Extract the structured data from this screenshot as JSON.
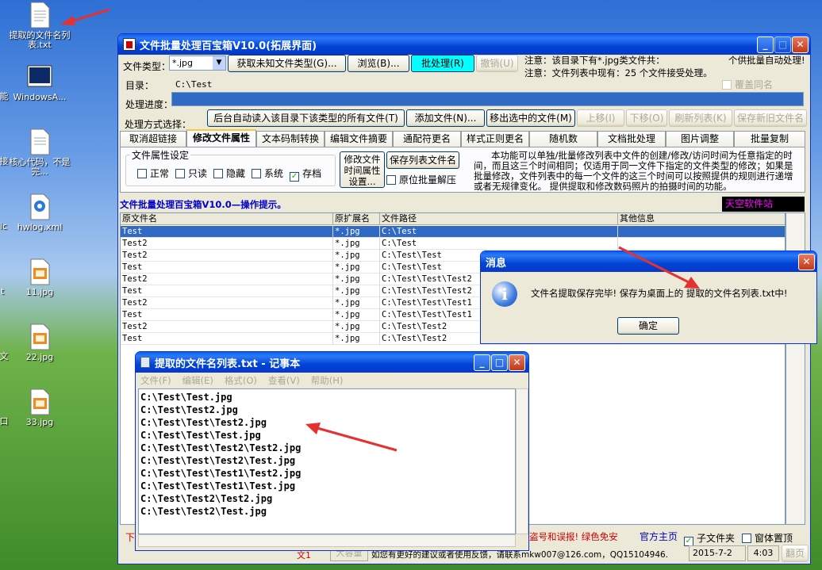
{
  "desktop": {
    "icons": [
      {
        "label": "提取的文件名列表.txt"
      },
      {
        "label": "WindowsA..."
      },
      {
        "label": "核心代码，不是完..."
      },
      {
        "label": "hwlog.xml"
      },
      {
        "label": "11.jpg"
      },
      {
        "label": "22.jpg"
      },
      {
        "label": "33.jpg"
      }
    ],
    "edge_chars": [
      "能",
      "接",
      "lic",
      "t",
      "文",
      "句",
      "口"
    ]
  },
  "app": {
    "title": "文件批量处理百宝箱V10.0(拓展界面)",
    "file_type_label": "文件类型：",
    "file_type_value": "*.jpg",
    "get_unknown_btn": "获取未知文件类型(G)...",
    "browse_btn": "浏览(B)...",
    "batch_btn": "批处理(R)",
    "undo_btn": "撤销(U)",
    "notice1": "注意：该目录下有*.jpg类文件共：",
    "notice1_tail": "个供批量自动处理!",
    "notice2": "注意：文件列表中现有：25 个文件接受处理。",
    "overwrite_label": "覆盖同名",
    "dir_label": "目录：",
    "dir_value": "C:\\Test",
    "progress_label": "处理进度：",
    "progress": 1.0,
    "method_label": "处理方式选择：",
    "auto_read_btn": "后台自动读入该目录下该类型的所有文件(T)",
    "add_file_btn": "添加文件(N)...",
    "remove_btn": "移出选中的文件(M)",
    "up_btn": "上移(I)",
    "down_btn": "下移(O)",
    "refresh_btn": "刷新列表(K)",
    "save_new_btn": "保存新旧文件名",
    "tabs": [
      "取消超链接",
      "修改文件属性",
      "文本码制转换",
      "编辑文件摘要",
      "通配符更名",
      "样式正则更名",
      "随机数",
      "文档批处理",
      "图片调整",
      "批量复制"
    ],
    "attr_group": "文件属性设定",
    "attrs": [
      {
        "label": "正常",
        "checked": false
      },
      {
        "label": "只读",
        "checked": false
      },
      {
        "label": "隐藏",
        "checked": false
      },
      {
        "label": "系统",
        "checked": false
      },
      {
        "label": "存档",
        "checked": true
      }
    ],
    "time_btn": "修改文件时间属性设置...",
    "save_list_btn": "保存列表文件名",
    "decompress_label": "原位批量解压",
    "desc": "本功能可以单独/批量修改列表中文件的创建/修改/访问时间为任意指定的时间，而且这三个时间相同；仅适用于同一文件下指定的文件类型的修改；如果是批量修改，文件列表中的每一个文件的这三个时间可以按照提供的规则进行递增或者无规律变化。 提供提取和修改数码照片的拍摄时间的功能。",
    "hint": "文件批量处理百宝箱V10.0—操作提示。",
    "site": "天空软件站",
    "columns": [
      "原文件名",
      "原扩展名",
      "文件路径",
      "其他信息"
    ],
    "rows": [
      [
        "Test",
        "*.jpg",
        "C:\\Test",
        ""
      ],
      [
        "Test2",
        "*.jpg",
        "C:\\Test",
        ""
      ],
      [
        "Test2",
        "*.jpg",
        "C:\\Test\\Test",
        ""
      ],
      [
        "Test",
        "*.jpg",
        "C:\\Test\\Test",
        ""
      ],
      [
        "Test2",
        "*.jpg",
        "C:\\Test\\Test\\Test2",
        ""
      ],
      [
        "Test",
        "*.jpg",
        "C:\\Test\\Test\\Test2",
        ""
      ],
      [
        "Test2",
        "*.jpg",
        "C:\\Test\\Test\\Test1",
        ""
      ],
      [
        "Test",
        "*.jpg",
        "C:\\Test\\Test\\Test1",
        ""
      ],
      [
        "Test2",
        "*.jpg",
        "C:\\Test\\Test2",
        ""
      ],
      [
        "Test",
        "*.jpg",
        "C:\\Test\\Test2",
        ""
      ]
    ],
    "status_left": "下",
    "status_warn": "盗号和误报! 绿色免安",
    "official": "官方主页",
    "subfolder_label": "子文件夹",
    "topmost_label": "窗体置顶",
    "bottom_big": "大容量",
    "bottom_msg": "如您有更好的建议或者使用反馈，请联系mkw007@126.com，QQ15104946.",
    "date": "2015-7-2",
    "time": "4:03",
    "page_btn": "翻页",
    "bottom_red": "文1"
  },
  "dialog": {
    "title": "消息",
    "message": "文件名提取保存完毕! 保存为桌面上的 提取的文件名列表.txt中!",
    "ok": "确定"
  },
  "notepad": {
    "title": "提取的文件名列表.txt - 记事本",
    "menu": [
      "文件(F)",
      "编辑(E)",
      "格式(O)",
      "查看(V)",
      "帮助(H)"
    ],
    "lines": [
      "C:\\Test\\Test.jpg",
      "C:\\Test\\Test2.jpg",
      "C:\\Test\\Test\\Test2.jpg",
      "C:\\Test\\Test\\Test.jpg",
      "C:\\Test\\Test\\Test2\\Test2.jpg",
      "C:\\Test\\Test\\Test2\\Test.jpg",
      "C:\\Test\\Test\\Test1\\Test2.jpg",
      "C:\\Test\\Test\\Test1\\Test.jpg",
      "C:\\Test\\Test2\\Test2.jpg",
      "C:\\Test\\Test2\\Test.jpg"
    ]
  },
  "colors": {
    "xp_blue": "#0044d6",
    "arrow_red": "#e53131",
    "progress": "#316ac5",
    "cyan_btn": "#00ffff",
    "site_bg": "#000000",
    "site_fg": "#ff00ff"
  }
}
